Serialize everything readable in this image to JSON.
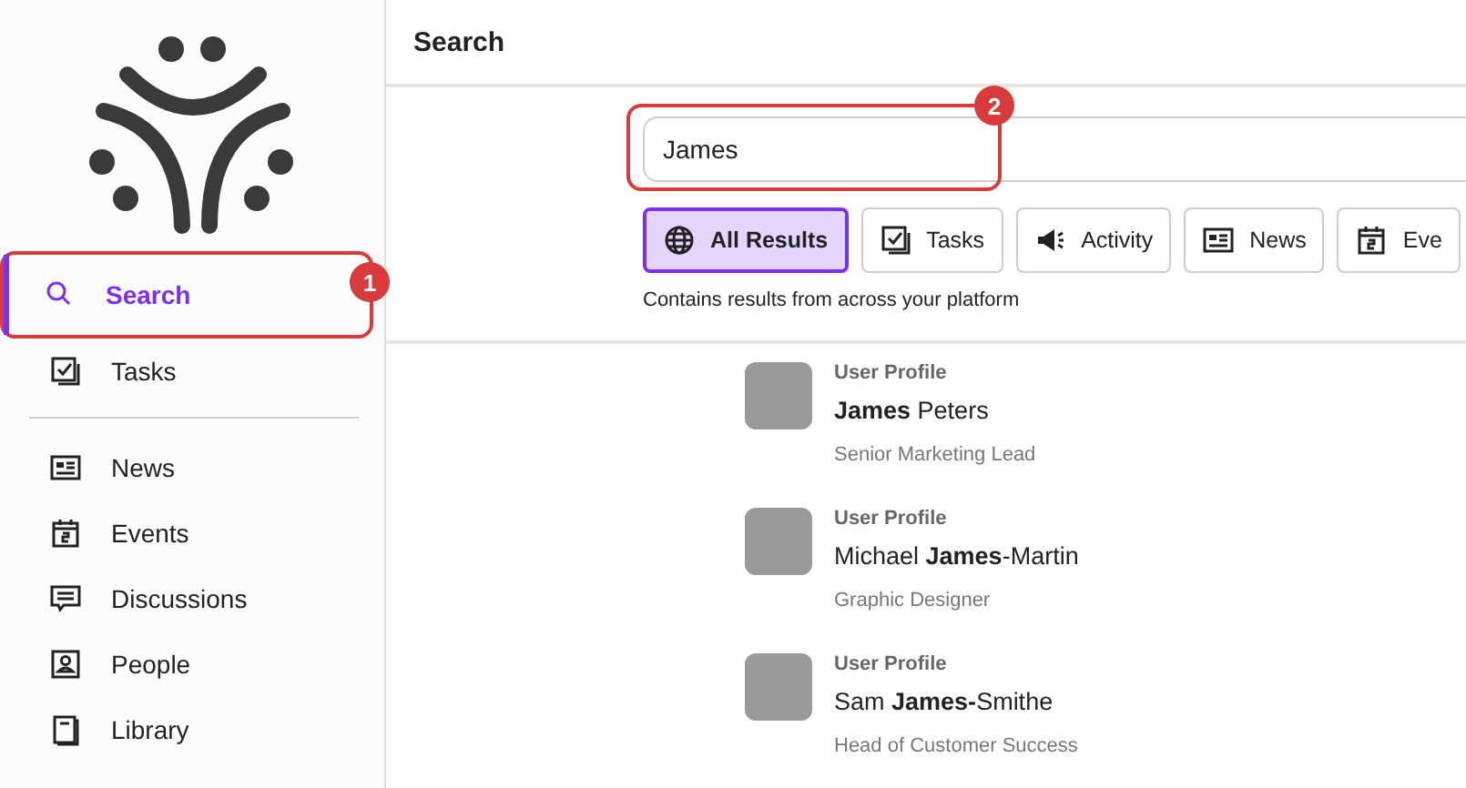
{
  "sidebar": {
    "items": [
      {
        "label": "Search",
        "selected": true
      },
      {
        "label": "Tasks",
        "selected": false
      },
      {
        "kind": "divider"
      },
      {
        "label": "News",
        "selected": false
      },
      {
        "label": "Events",
        "selected": false
      },
      {
        "label": "Discussions",
        "selected": false
      },
      {
        "label": "People",
        "selected": false
      },
      {
        "label": "Library",
        "selected": false
      }
    ]
  },
  "header": {
    "title": "Search"
  },
  "search": {
    "value": "James"
  },
  "filters": [
    {
      "label": "All Results",
      "selected": true
    },
    {
      "label": "Tasks",
      "selected": false
    },
    {
      "label": "Activity",
      "selected": false
    },
    {
      "label": "News",
      "selected": false
    },
    {
      "label": "Eve",
      "selected": false
    }
  ],
  "filter_caption": "Contains results from across your platform",
  "results": [
    {
      "type": "User Profile",
      "name": "**James** Peters",
      "subtitle": "Senior Marketing Lead"
    },
    {
      "type": "User Profile",
      "name": "Michael **James**-Martin",
      "subtitle": "Graphic Designer"
    },
    {
      "type": "User Profile",
      "name": "Sam **James-**Smithe",
      "subtitle": "Head of Customer Success"
    }
  ],
  "annotations": [
    {
      "number": "1"
    },
    {
      "number": "2"
    }
  ]
}
